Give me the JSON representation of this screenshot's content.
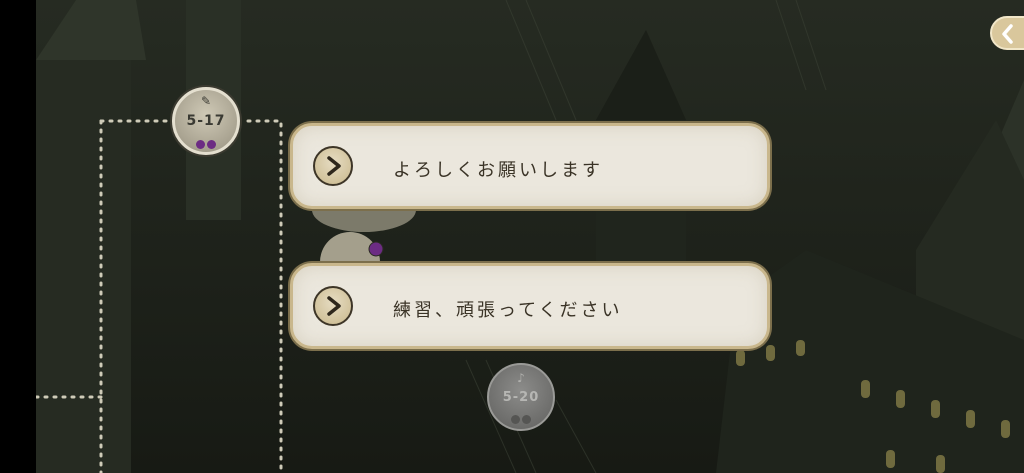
{
  "map": {
    "stages": [
      {
        "label": "5-17",
        "icon": "feather-icon",
        "glyph": "✎",
        "state": "active",
        "progress_dots": 2
      },
      {
        "label": "5-20",
        "icon": "music-note-icon",
        "glyph": "♪",
        "state": "locked",
        "progress_dots": 2
      }
    ]
  },
  "choices": [
    {
      "text": "よろしくお願いします",
      "icon": "play-arrow-icon"
    },
    {
      "text": "練習、頑張ってください",
      "icon": "play-arrow-icon"
    }
  ],
  "header": {
    "back_icon": "chevron-left-icon"
  },
  "colors": {
    "choice_bg": "#ebe7dd",
    "choice_border": "#c9b78c",
    "progress_dot": "#6c2c83",
    "back_button": "#d9c79c"
  }
}
